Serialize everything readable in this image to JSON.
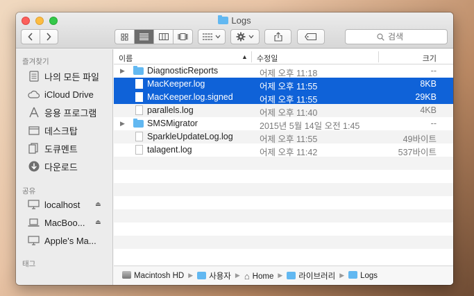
{
  "window": {
    "title": "Logs"
  },
  "toolbar": {
    "back_icon": "chevron-left-icon",
    "forward_icon": "chevron-right-icon",
    "view_modes": [
      "icon-view",
      "list-view",
      "column-view",
      "coverflow-view"
    ],
    "active_view": "list-view",
    "arrange_icon": "grid-icon",
    "action_icon": "gear-icon",
    "share_icon": "share-icon",
    "tag_icon": "tag-icon",
    "search_placeholder": "검색"
  },
  "sidebar": {
    "favorites_label": "즐겨찾기",
    "favorites": [
      {
        "label": "나의 모든 파일",
        "icon": "all-files-icon"
      },
      {
        "label": "iCloud Drive",
        "icon": "cloud-icon"
      },
      {
        "label": "응용 프로그램",
        "icon": "applications-icon"
      },
      {
        "label": "데스크탑",
        "icon": "desktop-icon"
      },
      {
        "label": "도큐멘트",
        "icon": "documents-icon"
      },
      {
        "label": "다운로드",
        "icon": "download-icon"
      }
    ],
    "shared_label": "공유",
    "shared": [
      {
        "label": "localhost",
        "eject": true
      },
      {
        "label": "MacBoo...",
        "eject": true
      },
      {
        "label": "Apple's Ma...",
        "eject": false
      }
    ],
    "tags_label": "태그"
  },
  "columns": {
    "name": "이름",
    "date": "수정일",
    "size": "크기"
  },
  "files": [
    {
      "name": "DiagnosticReports",
      "kind": "folder",
      "date": "어제 오후 11:18",
      "size": "--",
      "selected": false,
      "expandable": true
    },
    {
      "name": "MacKeeper.log",
      "kind": "doc",
      "date": "어제 오후 11:55",
      "size": "8KB",
      "selected": true,
      "expandable": false
    },
    {
      "name": "MacKeeper.log.signed",
      "kind": "doc",
      "date": "어제 오후 11:55",
      "size": "29KB",
      "selected": true,
      "expandable": false
    },
    {
      "name": "parallels.log",
      "kind": "doc",
      "date": "어제 오후 11:40",
      "size": "4KB",
      "selected": false,
      "expandable": false
    },
    {
      "name": "SMSMigrator",
      "kind": "folder",
      "date": "2015년 5월 14일 오전 1:45",
      "size": "--",
      "selected": false,
      "expandable": true
    },
    {
      "name": "SparkleUpdateLog.log",
      "kind": "doc",
      "date": "어제 오후 11:55",
      "size": "49바이트",
      "selected": false,
      "expandable": false
    },
    {
      "name": "talagent.log",
      "kind": "doc",
      "date": "어제 오후 11:42",
      "size": "537바이트",
      "selected": false,
      "expandable": false
    }
  ],
  "pathbar": [
    {
      "label": "Macintosh HD",
      "icon": "hard-drive-icon"
    },
    {
      "label": "사용자",
      "icon": "folder-icon"
    },
    {
      "label": "Home",
      "icon": "home-icon"
    },
    {
      "label": "라이브러리",
      "icon": "folder-icon"
    },
    {
      "label": "Logs",
      "icon": "folder-icon"
    }
  ]
}
